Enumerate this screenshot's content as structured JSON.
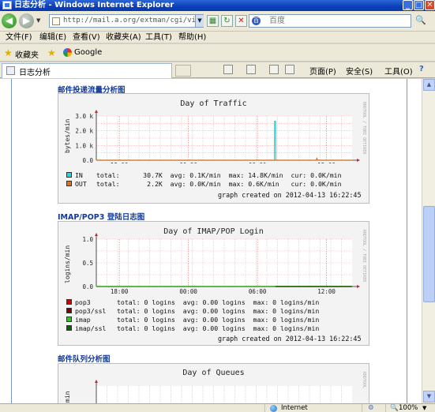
{
  "window": {
    "title": "日志分析 - Windows Internet Explorer",
    "controls": {
      "minimize": "_",
      "maximize": "□",
      "close": "✕"
    }
  },
  "addressbar": {
    "url": "http://mail.a.org/extman/cgi/viewlog.c",
    "search_placeholder": "百度"
  },
  "menu": [
    "文件(F)",
    "编辑(E)",
    "查看(V)",
    "收藏夹(A)",
    "工具(T)",
    "帮助(H)"
  ],
  "favorites": {
    "label": "收藏夹",
    "items": [
      "Google"
    ]
  },
  "tab": {
    "label": "日志分析"
  },
  "commands": {
    "page": "页面(P)",
    "safety": "安全(S)",
    "tools": "工具(O)"
  },
  "status": {
    "zone": "Internet",
    "zoom": "100%"
  },
  "sections": {
    "traffic": {
      "heading": "邮件投递流量分析图",
      "chart_title": "Day of Traffic",
      "ylabel": "bytes/min",
      "vertical_label": "RRDTOOL / TOBI OETIKER",
      "legend": [
        {
          "name": "IN",
          "line": "total:      30.7K  avg: 0.1K/min  max: 14.8K/min  cur: 0.0K/min",
          "color": "#00e5e5"
        },
        {
          "name": "OUT",
          "line": "total:       2.2K  avg: 0.0K/min  max: 0.6K/min   cur: 0.0K/min",
          "color": "#e07020"
        }
      ],
      "created": "graph created on 2012-04-13 16:22:45"
    },
    "imap": {
      "heading": "IMAP/POP3 登陆日志图",
      "chart_title": "Day of IMAP/POP Login",
      "ylabel": "logins/min",
      "vertical_label": "RRDTOOL / TOBI OETIKER",
      "legend": [
        {
          "name": "pop3",
          "line": "total: 0 logins  avg: 0.00 logins  max: 0 logins/min",
          "color": "#cc0000"
        },
        {
          "name": "pop3/ssl",
          "line": "total: 0 logins  avg: 0.00 logins  max: 0 logins/min",
          "color": "#800000"
        },
        {
          "name": "imap",
          "line": "total: 0 logins  avg: 0.00 logins  max: 0 logins/min",
          "color": "#22cc22"
        },
        {
          "name": "imap/ssl",
          "line": "total: 0 logins  avg: 0.00 logins  max: 0 logins/min",
          "color": "#006600"
        }
      ],
      "created": "graph created on 2012-04-13 16:22:45"
    },
    "queue": {
      "heading": "邮件队列分析图",
      "chart_title": "Day of Queues",
      "ylabel": "min",
      "vertical_label": "RRDTOOL"
    }
  },
  "chart_data": [
    {
      "type": "line",
      "title": "Day of Traffic",
      "xlabel": "",
      "ylabel": "bytes/min",
      "x_ticks": [
        "18:00",
        "00:00",
        "06:00",
        "12:00"
      ],
      "y_ticks": [
        "0.0",
        "1.0 k",
        "2.0 k",
        "3.0 k"
      ],
      "ylim": [
        0,
        3400
      ],
      "grid": true,
      "series": [
        {
          "name": "IN",
          "color": "#00e5e5",
          "points": [
            [
              0.0,
              0
            ],
            [
              0.696,
              0
            ],
            [
              0.697,
              3000
            ],
            [
              0.701,
              3000
            ],
            [
              0.702,
              0
            ],
            [
              1.0,
              0
            ]
          ]
        },
        {
          "name": "OUT",
          "color": "#e07020",
          "points": [
            [
              0.0,
              0
            ],
            [
              0.86,
              0
            ],
            [
              0.862,
              150
            ],
            [
              0.866,
              0
            ],
            [
              1.0,
              0
            ]
          ]
        }
      ]
    },
    {
      "type": "line",
      "title": "Day of IMAP/POP Login",
      "xlabel": "",
      "ylabel": "logins/min",
      "x_ticks": [
        "18:00",
        "00:00",
        "06:00",
        "12:00"
      ],
      "y_ticks": [
        "0.0",
        "0.5",
        "1.0"
      ],
      "ylim": [
        0,
        1
      ],
      "grid": true,
      "series": [
        {
          "name": "pop3",
          "color": "#cc0000",
          "points": [
            [
              0.0,
              0
            ],
            [
              1.0,
              0
            ]
          ]
        },
        {
          "name": "pop3/ssl",
          "color": "#800000",
          "points": [
            [
              0.0,
              0
            ],
            [
              1.0,
              0
            ]
          ]
        },
        {
          "name": "imap",
          "color": "#22cc22",
          "points": [
            [
              0.0,
              0
            ],
            [
              1.0,
              0
            ]
          ]
        },
        {
          "name": "imap/ssl",
          "color": "#006600",
          "points": [
            [
              0.7,
              0
            ],
            [
              1.0,
              0
            ]
          ]
        }
      ]
    },
    {
      "type": "line",
      "title": "Day of Queues",
      "grid": true,
      "series": []
    }
  ]
}
